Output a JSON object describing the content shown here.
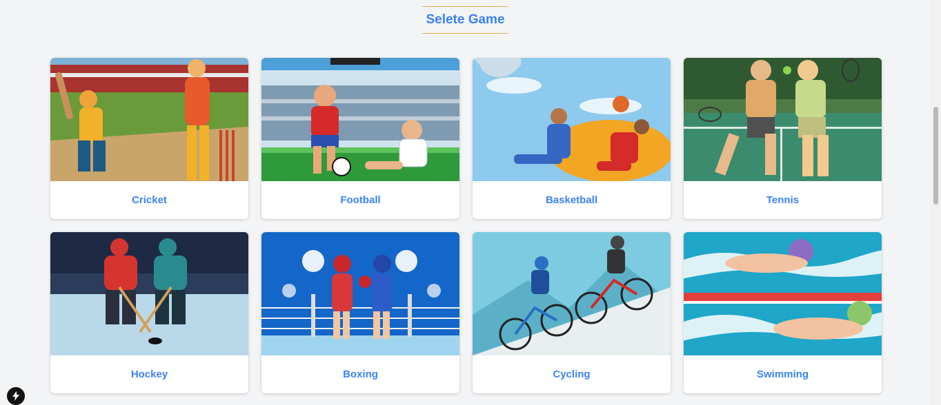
{
  "page": {
    "title": "Selete Game"
  },
  "games": [
    {
      "id": "cricket",
      "label": "Cricket"
    },
    {
      "id": "football",
      "label": "Football"
    },
    {
      "id": "basketball",
      "label": "Basketball"
    },
    {
      "id": "tennis",
      "label": "Tennis"
    },
    {
      "id": "hockey",
      "label": "Hockey"
    },
    {
      "id": "boxing",
      "label": "Boxing"
    },
    {
      "id": "cycling",
      "label": "Cycling"
    },
    {
      "id": "swimming",
      "label": "Swimming"
    }
  ],
  "colors": {
    "accent": "#3b82f6",
    "heading_rule": "#e0b64b",
    "page_bg": "#f3f4f6"
  },
  "icons": {
    "dev_badge": "lightning-icon"
  }
}
